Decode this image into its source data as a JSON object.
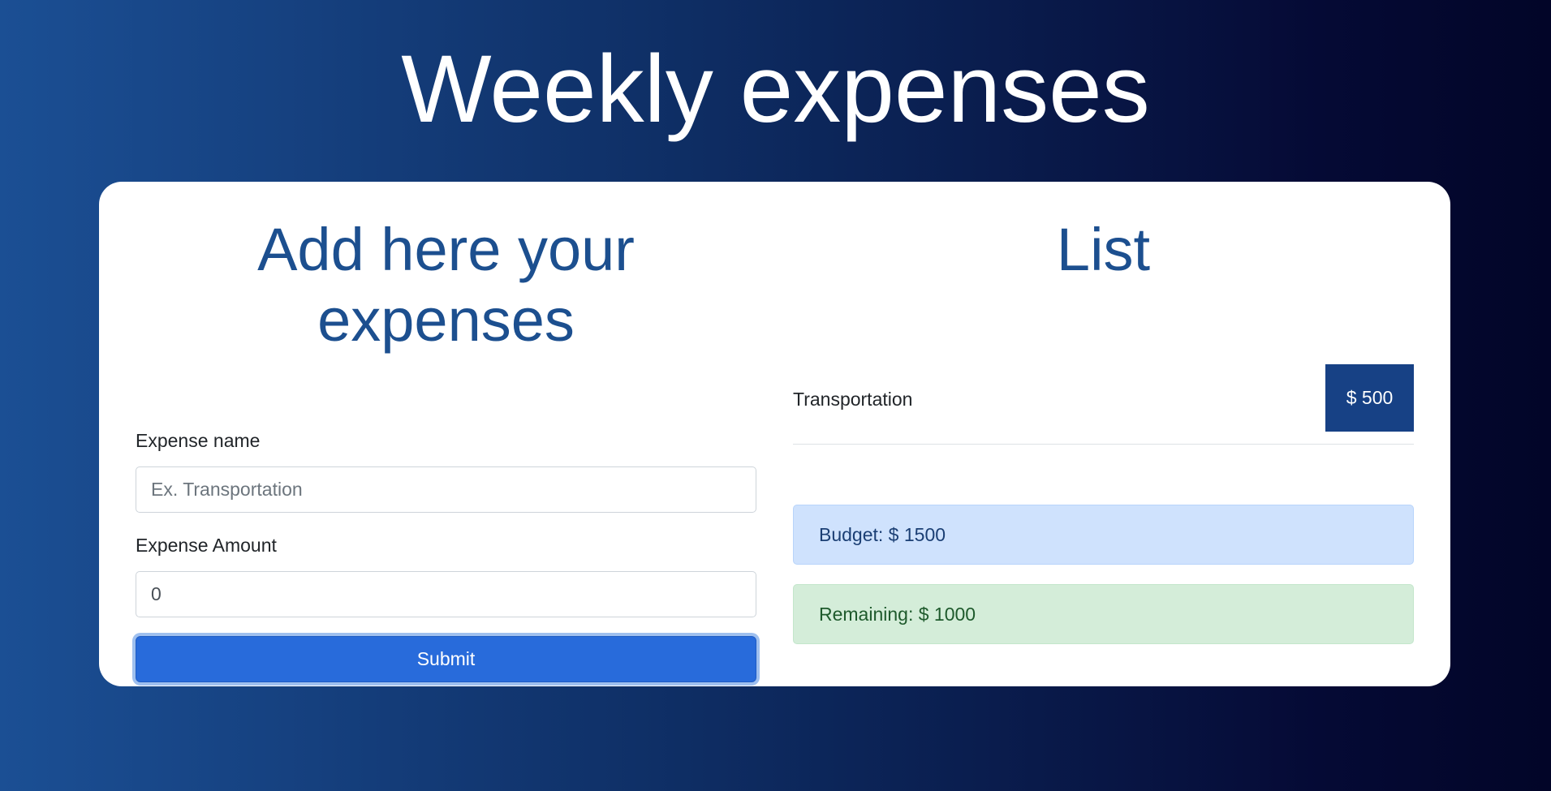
{
  "page": {
    "title": "Weekly expenses"
  },
  "form": {
    "title": "Add here your expenses",
    "name_label": "Expense name",
    "name_placeholder": "Ex. Transportation",
    "name_value": "",
    "amount_label": "Expense Amount",
    "amount_value": "0",
    "submit_label": "Submit"
  },
  "list": {
    "title": "List",
    "items": [
      {
        "name": "Transportation",
        "amount": "$ 500"
      }
    ],
    "budget_text": "Budget: $ 1500",
    "remaining_text": "Remaining: $ 1000"
  },
  "colors": {
    "title_blue": "#1c4f8f",
    "submit_blue": "#286bdb",
    "badge_blue": "#174185",
    "budget_bg": "#cfe2fd",
    "remaining_bg": "#d4edd9"
  }
}
